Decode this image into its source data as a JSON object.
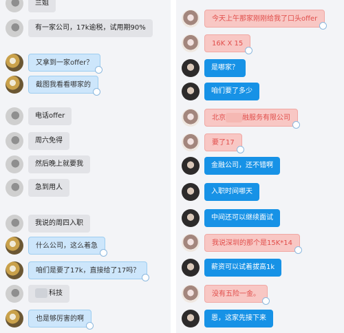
{
  "left": {
    "messages": [
      {
        "text": "兰姐"
      },
      {
        "text": "有一家公司，17k逾税，试用期90%"
      },
      {
        "text": "又拿到一家offer？"
      },
      {
        "text": "截图我看看哪家的"
      },
      {
        "text": "电话offer"
      },
      {
        "text": "周六免得"
      },
      {
        "text": "然后晚上就要我"
      },
      {
        "text": "急到用人"
      },
      {
        "text": "我说的周四入职"
      },
      {
        "text": "什么公司，这么着急"
      },
      {
        "text": "咱们是要了17k，直接给了17吗？"
      },
      {
        "text": "科技"
      },
      {
        "text": "也是够厉害的啊"
      }
    ]
  },
  "right": {
    "messages": [
      {
        "text": "今天上午那家刚刚给我了口头offer"
      },
      {
        "text": "16K X 15"
      },
      {
        "text": "是哪家？"
      },
      {
        "text": "咱们要了多少"
      },
      {
        "text": "北京",
        "text_after": "融服务有限公司"
      },
      {
        "text": "要了17"
      },
      {
        "text": "金融公司，还不错啊"
      },
      {
        "text": "入职时间哪天"
      },
      {
        "text": "中间还可以继续面试"
      },
      {
        "text": "我说深圳的那个是15K*14"
      },
      {
        "text": "薪资可以试着拔高1k"
      },
      {
        "text": "没有五险一金。"
      },
      {
        "text": "恩，这家先接下来"
      }
    ]
  }
}
